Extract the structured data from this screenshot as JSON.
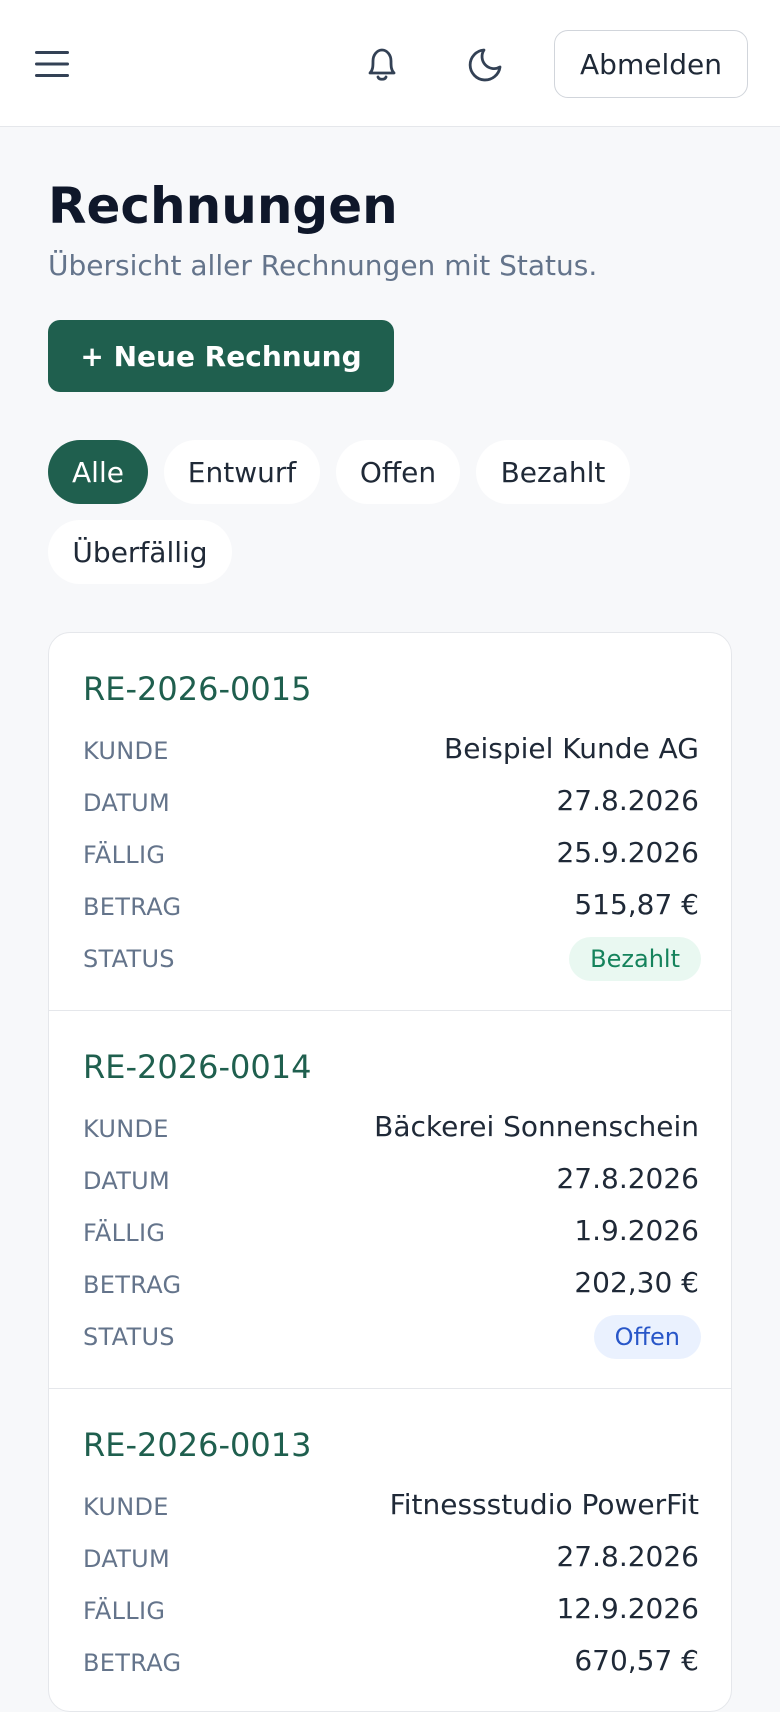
{
  "header": {
    "menu_icon": "hamburger-menu-icon",
    "notifications_icon": "bell-icon",
    "theme_icon": "moon-icon",
    "logout_label": "Abmelden"
  },
  "page": {
    "title": "Rechnungen",
    "subtitle": "Übersicht aller Rechnungen mit Status.",
    "new_invoice_label": "+ Neue Rechnung"
  },
  "filters": [
    {
      "label": "Alle",
      "active": true
    },
    {
      "label": "Entwurf",
      "active": false
    },
    {
      "label": "Offen",
      "active": false
    },
    {
      "label": "Bezahlt",
      "active": false
    },
    {
      "label": "Überfällig",
      "active": false
    }
  ],
  "labels": {
    "customer": "KUNDE",
    "date": "DATUM",
    "due": "FÄLLIG",
    "amount": "BETRAG",
    "status": "STATUS"
  },
  "invoices": [
    {
      "number": "RE-2026-0015",
      "customer": "Beispiel Kunde AG",
      "date": "27.8.2026",
      "due": "25.9.2026",
      "amount": "515,87 €",
      "status": "Bezahlt"
    },
    {
      "number": "RE-2026-0014",
      "customer": "Bäckerei Sonnenschein",
      "date": "27.8.2026",
      "due": "1.9.2026",
      "amount": "202,30 €",
      "status": "Offen"
    },
    {
      "number": "RE-2026-0013",
      "customer": "Fitnessstudio PowerFit",
      "date": "27.8.2026",
      "due": "12.9.2026",
      "amount": "670,57 €",
      "status": ""
    }
  ],
  "colors": {
    "brand": "#1f5f4e",
    "paid_bg": "#e9f8f1",
    "paid_text": "#15835c",
    "open_bg": "#eaf1fe",
    "open_text": "#2856c8"
  }
}
